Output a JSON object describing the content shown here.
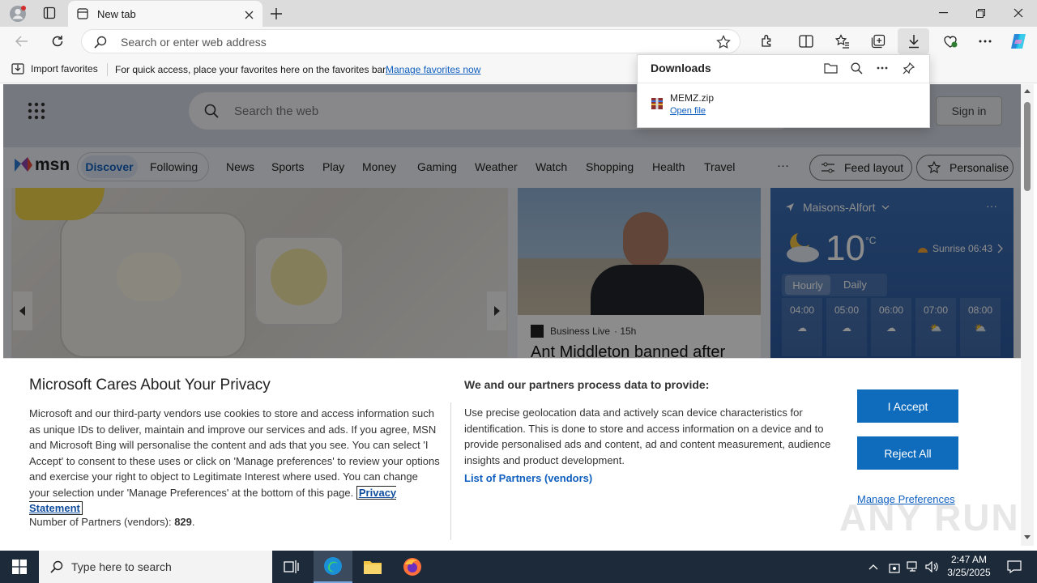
{
  "browser": {
    "tab_title": "New tab",
    "address_placeholder": "Search or enter web address",
    "fav_import": "Import favorites",
    "fav_hint": "For quick access, place your favorites here on the favorites bar.",
    "fav_manage": "Manage favorites now"
  },
  "downloads": {
    "title": "Downloads",
    "file_name": "MEMZ.zip",
    "open_file": "Open file"
  },
  "msn": {
    "search_placeholder": "Search the web",
    "sign_in": "Sign in",
    "logo": "msn",
    "nav": [
      "Discover",
      "Following",
      "News",
      "Sports",
      "Play",
      "Money",
      "Gaming",
      "Weather",
      "Watch",
      "Shopping",
      "Health",
      "Travel"
    ],
    "more": "···",
    "feed_layout": "Feed layout",
    "personalise": "Personalise",
    "news_source": "Business Live",
    "news_age": "· 15h",
    "news_headline": "Ant Middleton banned after",
    "weather": {
      "location": "Maisons-Alfort",
      "temp": "10",
      "unit": "°C",
      "sunrise": "Sunrise 06:43",
      "tabs": [
        "Hourly",
        "Daily"
      ],
      "hours": [
        "04:00",
        "05:00",
        "06:00",
        "07:00",
        "08:00"
      ]
    }
  },
  "privacy": {
    "title": "Microsoft Cares About Your Privacy",
    "body": "Microsoft and our third-party vendors use cookies to store and access information such as unique IDs to deliver, maintain and improve our services and ads. If you agree, MSN and Microsoft Bing will personalise the content and ads that you see. You can select 'I Accept' to consent to these uses or click on 'Manage preferences' to review your options and exercise your right to object to Legitimate Interest where used.  You can change your selection under 'Manage Preferences' at the bottom of this page.",
    "privacy_link": "Privacy Statement",
    "partners_label": "Number of Partners (vendors):",
    "partners_count": "829",
    "partners_period": ".",
    "right_title": "We and our partners process data to provide:",
    "right_body": "Use precise geolocation data and actively scan device characteristics for identification. This is done to store and access information on a device and to provide personalised ads and content, ad and content measurement, audience insights and product development.",
    "list_link": "List of Partners (vendors)",
    "accept": "I Accept",
    "reject": "Reject All",
    "manage": "Manage Preferences"
  },
  "taskbar": {
    "search_placeholder": "Type here to search",
    "time": "2:47 AM",
    "date": "3/25/2025"
  },
  "watermark": "ANY RUN"
}
